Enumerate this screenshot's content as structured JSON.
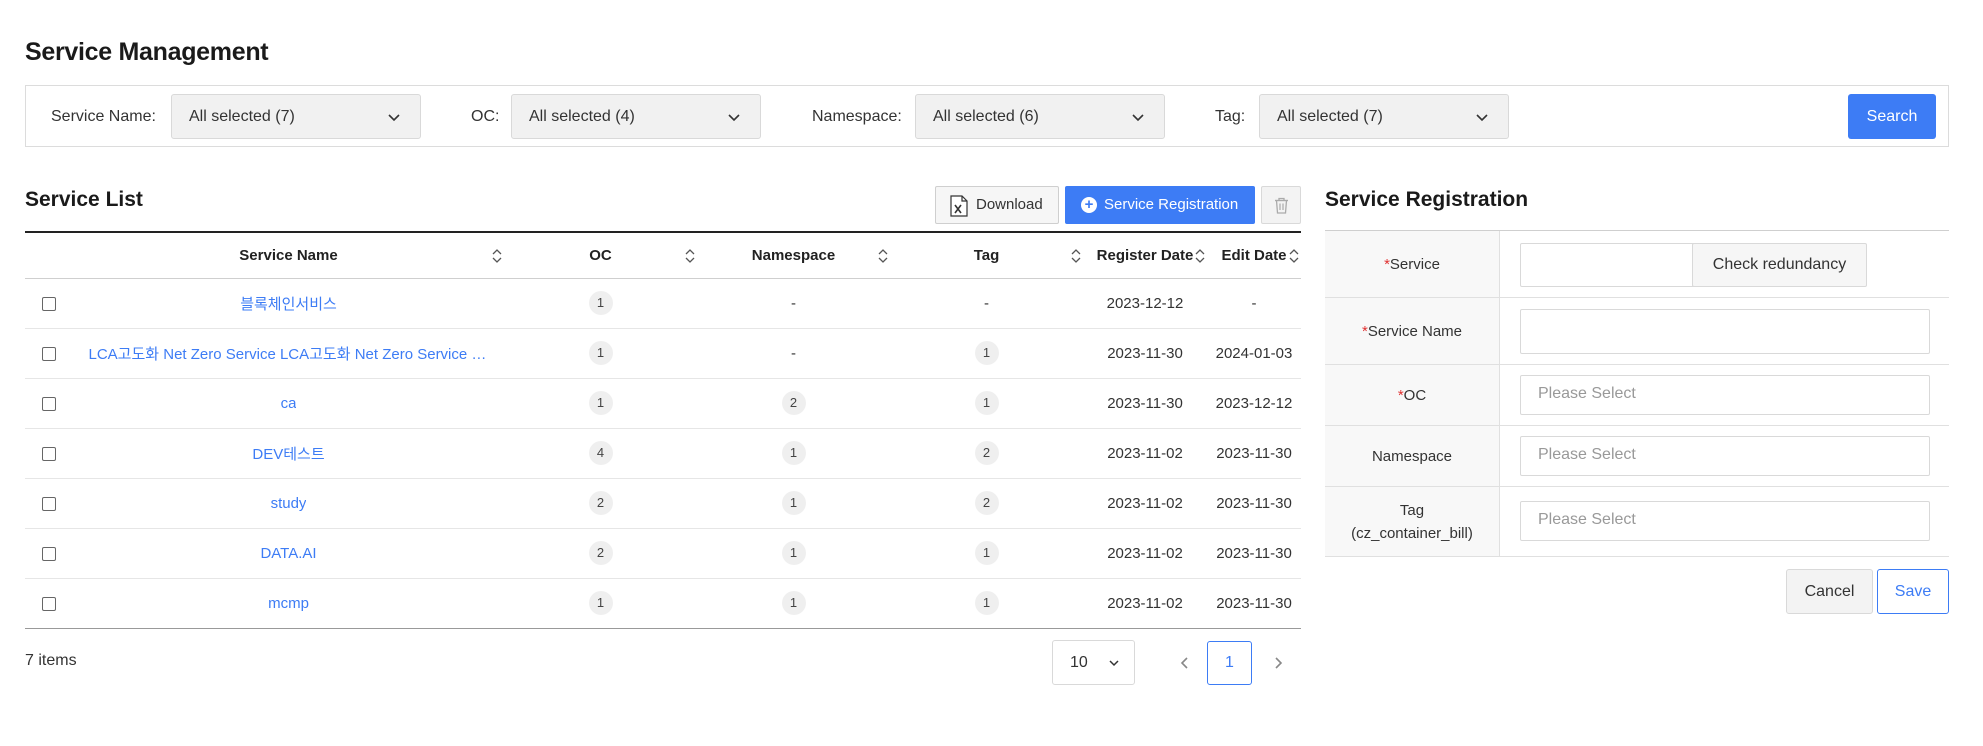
{
  "page": {
    "title": "Service Management"
  },
  "filters": {
    "service_name": {
      "label": "Service Name:",
      "value": "All selected (7)"
    },
    "oc": {
      "label": "OC:",
      "value": "All selected (4)"
    },
    "namespace": {
      "label": "Namespace:",
      "value": "All selected (6)"
    },
    "tag": {
      "label": "Tag:",
      "value": "All selected (7)"
    },
    "search_label": "Search"
  },
  "service_list": {
    "title": "Service List",
    "download_label": "Download",
    "register_label": "Service Registration",
    "columns": [
      "Service Name",
      "OC",
      "Namespace",
      "Tag",
      "Register Date",
      "Edit Date"
    ],
    "rows": [
      {
        "name": "블록체인서비스",
        "oc": "1",
        "namespace": "-",
        "tag": "-",
        "register_date": "2023-12-12",
        "edit_date": "-"
      },
      {
        "name": "LCA고도화 Net Zero Service LCA고도화 Net Zero Service L...",
        "oc": "1",
        "namespace": "-",
        "tag": "1",
        "register_date": "2023-11-30",
        "edit_date": "2024-01-03"
      },
      {
        "name": "ca",
        "oc": "1",
        "namespace": "2",
        "tag": "1",
        "register_date": "2023-11-30",
        "edit_date": "2023-12-12"
      },
      {
        "name": "DEV테스트",
        "oc": "4",
        "namespace": "1",
        "tag": "2",
        "register_date": "2023-11-02",
        "edit_date": "2023-11-30"
      },
      {
        "name": "study",
        "oc": "2",
        "namespace": "1",
        "tag": "2",
        "register_date": "2023-11-02",
        "edit_date": "2023-11-30"
      },
      {
        "name": "DATA.AI",
        "oc": "2",
        "namespace": "1",
        "tag": "1",
        "register_date": "2023-11-02",
        "edit_date": "2023-11-30"
      },
      {
        "name": "mcmp",
        "oc": "1",
        "namespace": "1",
        "tag": "1",
        "register_date": "2023-11-02",
        "edit_date": "2023-11-30"
      }
    ],
    "items_count": "7 items",
    "page_size": "10",
    "current_page": "1"
  },
  "registration": {
    "title": "Service Registration",
    "service_label": "Service",
    "service_value": "",
    "check_label": "Check redundancy",
    "service_name_label": "Service Name",
    "service_name_value": "",
    "oc_label": "OC",
    "oc_placeholder": "Please Select",
    "namespace_label": "Namespace",
    "namespace_placeholder": "Please Select",
    "tag_label": "Tag",
    "tag_sublabel": "(cz_container_bill)",
    "tag_placeholder": "Please Select",
    "required_mark": "*",
    "cancel_label": "Cancel",
    "save_label": "Save"
  },
  "colors": {
    "accent": "#3d7cf5",
    "required": "#e03131"
  }
}
